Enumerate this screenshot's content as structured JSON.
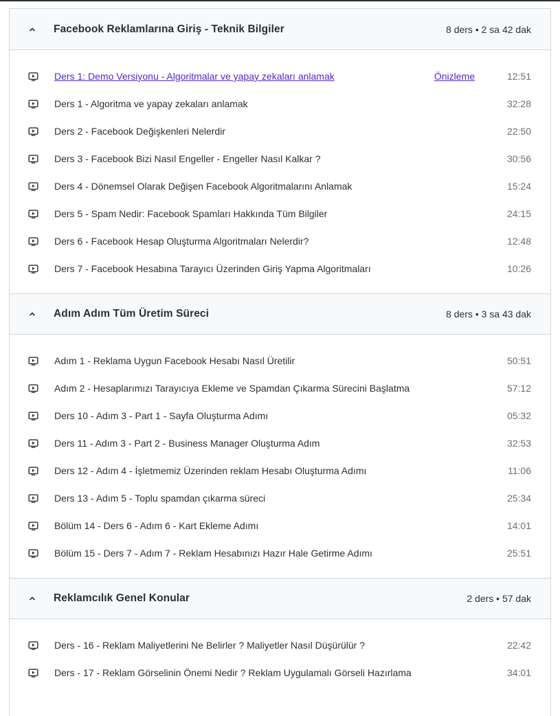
{
  "sections": [
    {
      "title": "Facebook Reklamlarına Giriş - Teknik Bilgiler",
      "meta": "8 ders • 2 sa 42 dak",
      "lectures": [
        {
          "title": "Ders 1: Demo Versiyonu - Algoritmalar ve yapay zekaları anlamak",
          "duration": "12:51",
          "preview": "Önizleme",
          "link": true
        },
        {
          "title": "Ders 1 - Algoritma ve yapay zekaları anlamak",
          "duration": "32:28"
        },
        {
          "title": "Ders 2 - Facebook Değişkenleri Nelerdir",
          "duration": "22:50"
        },
        {
          "title": "Ders 3 - Facebook Bizi Nasıl Engeller - Engeller Nasıl Kalkar ?",
          "duration": "30:56"
        },
        {
          "title": "Ders 4 - Dönemsel Olarak Değişen Facebook Algoritmalarını Anlamak",
          "duration": "15:24"
        },
        {
          "title": "Ders 5 - Spam Nedir: Facebook Spamları Hakkında Tüm Bilgiler",
          "duration": "24:15"
        },
        {
          "title": "Ders 6 - Facebook Hesap Oluşturma Algoritmaları Nelerdir?",
          "duration": "12:48"
        },
        {
          "title": "Ders 7 - Facebook Hesabına Tarayıcı Üzerinden Giriş Yapma Algoritmaları",
          "duration": "10:26"
        }
      ]
    },
    {
      "title": "Adım Adım Tüm Üretim Süreci",
      "meta": "8 ders • 3 sa 43 dak",
      "lectures": [
        {
          "title": "Adım 1 - Reklama Uygun Facebook Hesabı Nasıl Üretilir",
          "duration": "50:51"
        },
        {
          "title": "Adım 2 - Hesaplarımızı Tarayıcıya Ekleme ve Spamdan Çıkarma Sürecini Başlatma",
          "duration": "57:12"
        },
        {
          "title": "Ders 10 - Adım 3 - Part 1 - Sayfa Oluşturma Adımı",
          "duration": "05:32"
        },
        {
          "title": "Ders 11 - Adım 3 - Part 2 - Business Manager Oluşturma Adım",
          "duration": "32:53"
        },
        {
          "title": "Ders 12 - Adım 4 - İşletmemiz Üzerinden reklam Hesabı Oluşturma Adımı",
          "duration": "11:06"
        },
        {
          "title": "Ders 13 - Adım 5 - Toplu spamdan çıkarma süreci",
          "duration": "25:34"
        },
        {
          "title": "Bölüm 14 - Ders 6 - Adım 6 - Kart Ekleme Adımı",
          "duration": "14:01"
        },
        {
          "title": "Bölüm 15 - Ders 7 - Adım 7 - Reklam Hesabınızı Hazır Hale Getirme Adımı",
          "duration": "25:51"
        }
      ]
    },
    {
      "title": "Reklamcılık Genel Konular",
      "meta": "2 ders • 57 dak",
      "lectures": [
        {
          "title": "Ders - 16 - Reklam Maliyetlerini Ne Belirler ? Maliyetler Nasıl Düşürülür ?",
          "duration": "22:42"
        },
        {
          "title": "Ders - 17 - Reklam Görselinin Önemi Nedir ? Reklam Uygulamalı Görseli Hazırlama",
          "duration": "34:01"
        }
      ]
    }
  ],
  "icons": {
    "section_toggle": "chevron-up-icon",
    "lecture": "video-play-icon"
  },
  "colors": {
    "link": "#5624d0",
    "text": "#2d2f31",
    "muted": "#6a6f73",
    "header_bg": "#f7f9fa",
    "border": "#d1d7dc"
  }
}
